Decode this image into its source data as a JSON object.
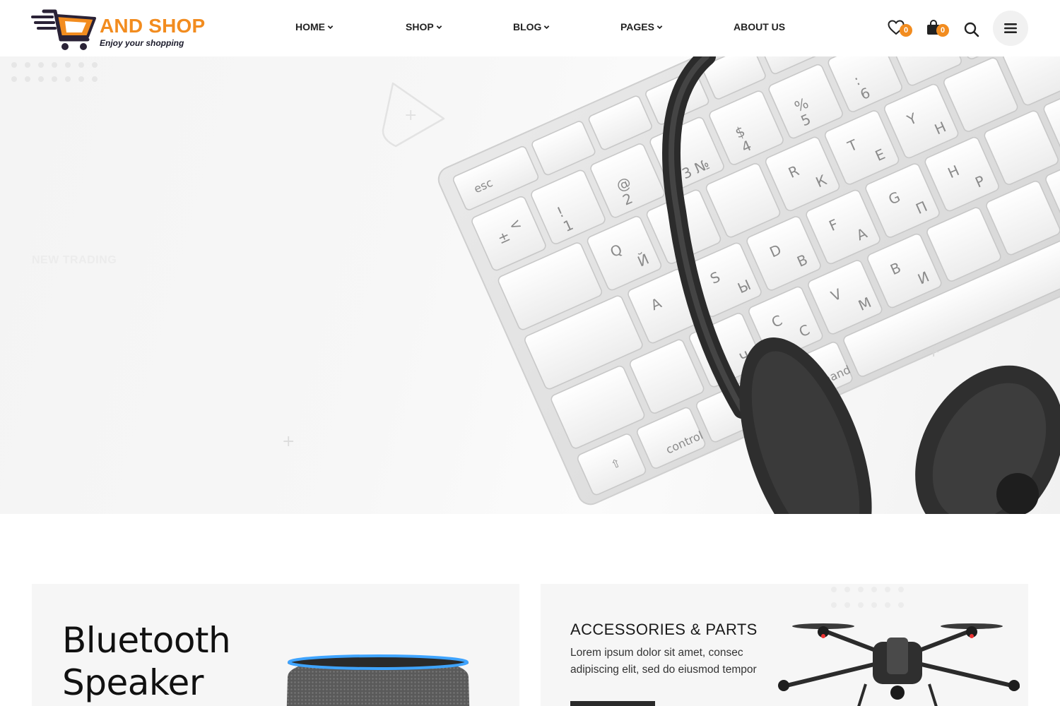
{
  "brand": {
    "name": "AND SHOP",
    "tagline": "Enjoy your shopping",
    "accent_color": "#f28c1f"
  },
  "nav": {
    "items": [
      {
        "label": "HOME",
        "has_dropdown": true
      },
      {
        "label": "SHOP",
        "has_dropdown": true
      },
      {
        "label": "BLOG",
        "has_dropdown": true
      },
      {
        "label": "PAGES",
        "has_dropdown": true
      },
      {
        "label": "ABOUT US",
        "has_dropdown": false
      }
    ]
  },
  "header_actions": {
    "wishlist": {
      "icon": "heart-icon",
      "count": "0"
    },
    "cart": {
      "icon": "shopping-bag-icon",
      "count": "0"
    },
    "search": {
      "icon": "search-icon"
    },
    "menu": {
      "icon": "hamburger-icon"
    }
  },
  "hero": {
    "kicker": "NEW TRADING",
    "image": "keyboard-and-headset-photo"
  },
  "banners": {
    "left": {
      "title_line1": "Bluetooth",
      "title_line2": "Speaker",
      "image": "smart-speaker-photo"
    },
    "right": {
      "title": "ACCESSORIES & PARTS",
      "text": "Lorem ipsum dolor sit amet, consec adipiscing elit, sed do eiusmod tempor",
      "image": "drone-photo"
    }
  }
}
